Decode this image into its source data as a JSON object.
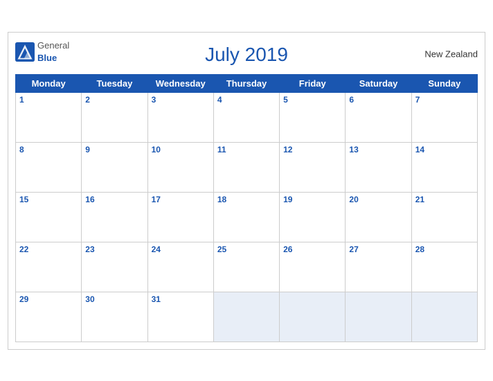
{
  "header": {
    "title": "July 2019",
    "country": "New Zealand",
    "logo_general": "General",
    "logo_blue": "Blue"
  },
  "weekdays": [
    "Monday",
    "Tuesday",
    "Wednesday",
    "Thursday",
    "Friday",
    "Saturday",
    "Sunday"
  ],
  "weeks": [
    [
      1,
      2,
      3,
      4,
      5,
      6,
      7
    ],
    [
      8,
      9,
      10,
      11,
      12,
      13,
      14
    ],
    [
      15,
      16,
      17,
      18,
      19,
      20,
      21
    ],
    [
      22,
      23,
      24,
      25,
      26,
      27,
      28
    ],
    [
      29,
      30,
      31,
      null,
      null,
      null,
      null
    ]
  ]
}
